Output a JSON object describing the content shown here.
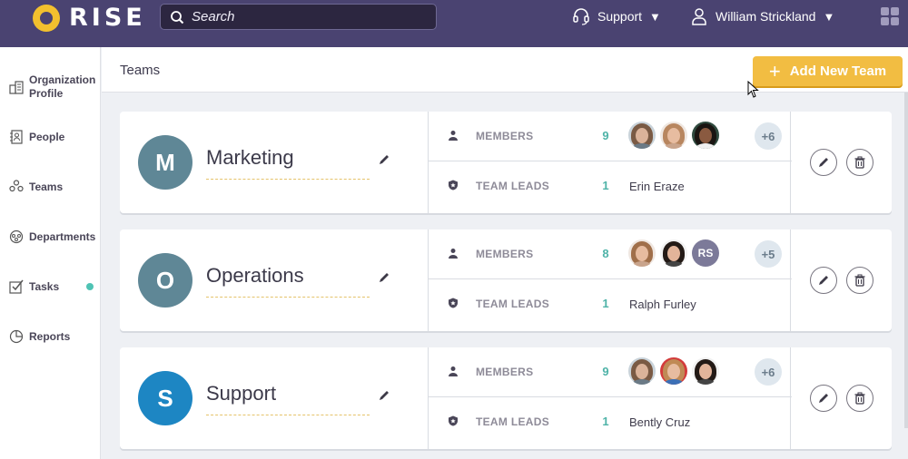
{
  "app": {
    "name": "RISE",
    "accent": "#f2c02e",
    "topbar_color": "#4a4371"
  },
  "search": {
    "placeholder": "Search",
    "icon": "search-icon"
  },
  "topnav": {
    "support_label": "Support",
    "support_icon": "headset-icon",
    "user_name": "William Strickland",
    "user_icon": "user-icon",
    "apps_icon": "apps-grid-icon"
  },
  "sidebar": {
    "items": [
      {
        "label": "Organization Profile",
        "icon": "building-icon"
      },
      {
        "label": "People",
        "icon": "address-book-icon"
      },
      {
        "label": "Teams",
        "icon": "teams-icon"
      },
      {
        "label": "Departments",
        "icon": "departments-icon"
      },
      {
        "label": "Tasks",
        "icon": "checkbox-icon",
        "has_dot": true
      },
      {
        "label": "Reports",
        "icon": "pie-chart-icon"
      }
    ]
  },
  "header": {
    "title": "Teams",
    "add_button_label": "Add New Team"
  },
  "teams": [
    {
      "initial": "M",
      "name": "Marketing",
      "avatar_color": "#5f8796",
      "members_label": "MEMBERS",
      "members_count": "9",
      "members_avatars": [
        "photo-man-beard",
        "photo-woman-light",
        "photo-woman-dark"
      ],
      "members_more": "+6",
      "leads_label": "TEAM LEADS",
      "leads_count": "1",
      "lead_name": "Erin Eraze"
    },
    {
      "initial": "O",
      "name": "Operations",
      "avatar_color": "#5f8796",
      "members_label": "MEMBERS",
      "members_count": "8",
      "members_avatars": [
        "photo-woman-light",
        "photo-woman-glasses",
        "initials-RS"
      ],
      "members_initials": "RS",
      "members_more": "+5",
      "leads_label": "TEAM LEADS",
      "leads_count": "1",
      "lead_name": "Ralph Furley"
    },
    {
      "initial": "S",
      "name": "Support",
      "avatar_color": "#1d86c3",
      "members_label": "MEMBERS",
      "members_count": "9",
      "members_avatars": [
        "photo-man-beard",
        "photo-woman-red",
        "photo-woman-glasses"
      ],
      "members_more": "+6",
      "leads_label": "TEAM LEADS",
      "leads_count": "1",
      "lead_name": "Bently Cruz"
    }
  ]
}
